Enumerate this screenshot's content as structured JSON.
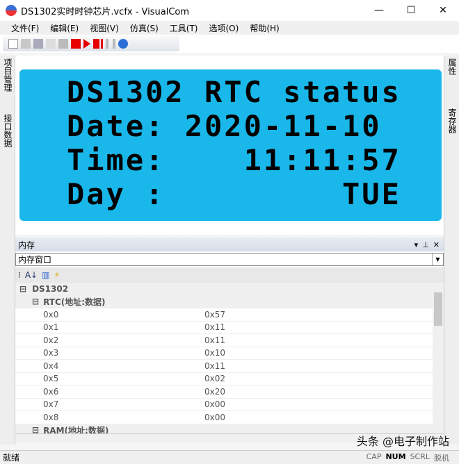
{
  "window": {
    "title": "DS1302实时时钟芯片.vcfx - VisualCom",
    "minimize": "—",
    "maximize": "☐",
    "close": "✕"
  },
  "menu": [
    "文件(F)",
    "编辑(E)",
    "视图(V)",
    "仿真(S)",
    "工具(T)",
    "选项(O)",
    "帮助(H)"
  ],
  "toolbar": {
    "icons": [
      "new-icon",
      "open-icon",
      "save-icon",
      "copy-icon",
      "paste-icon",
      "stop-icon",
      "run-icon",
      "step-icon",
      "pause-icon",
      "help-icon"
    ],
    "accent": "#e60000"
  },
  "left_tabs": [
    "项目管理",
    "接口数据"
  ],
  "right_tabs": [
    "属性",
    "寄存器"
  ],
  "lcd": {
    "color": "#19b7ea",
    "lines": [
      "DS1302 RTC status",
      "Date: 2020-11-10",
      "Time:    11:11:57",
      "Day :         TUE"
    ]
  },
  "memory": {
    "title": "内存",
    "combo_value": "内存窗口",
    "root": "DS1302",
    "rtc_group": "RTC(地址:数据)",
    "rows": [
      [
        "0x0",
        "0x57"
      ],
      [
        "0x1",
        "0x11"
      ],
      [
        "0x2",
        "0x11"
      ],
      [
        "0x3",
        "0x10"
      ],
      [
        "0x4",
        "0x11"
      ],
      [
        "0x5",
        "0x02"
      ],
      [
        "0x6",
        "0x20"
      ],
      [
        "0x7",
        "0x00"
      ],
      [
        "0x8",
        "0x00"
      ]
    ],
    "ram_group": "RAM(地址:数据)"
  },
  "status": {
    "text": "就绪",
    "indicators": [
      "CAP",
      "NUM",
      "SCRL",
      "脱机"
    ]
  },
  "watermark": "头条 @电子制作站"
}
